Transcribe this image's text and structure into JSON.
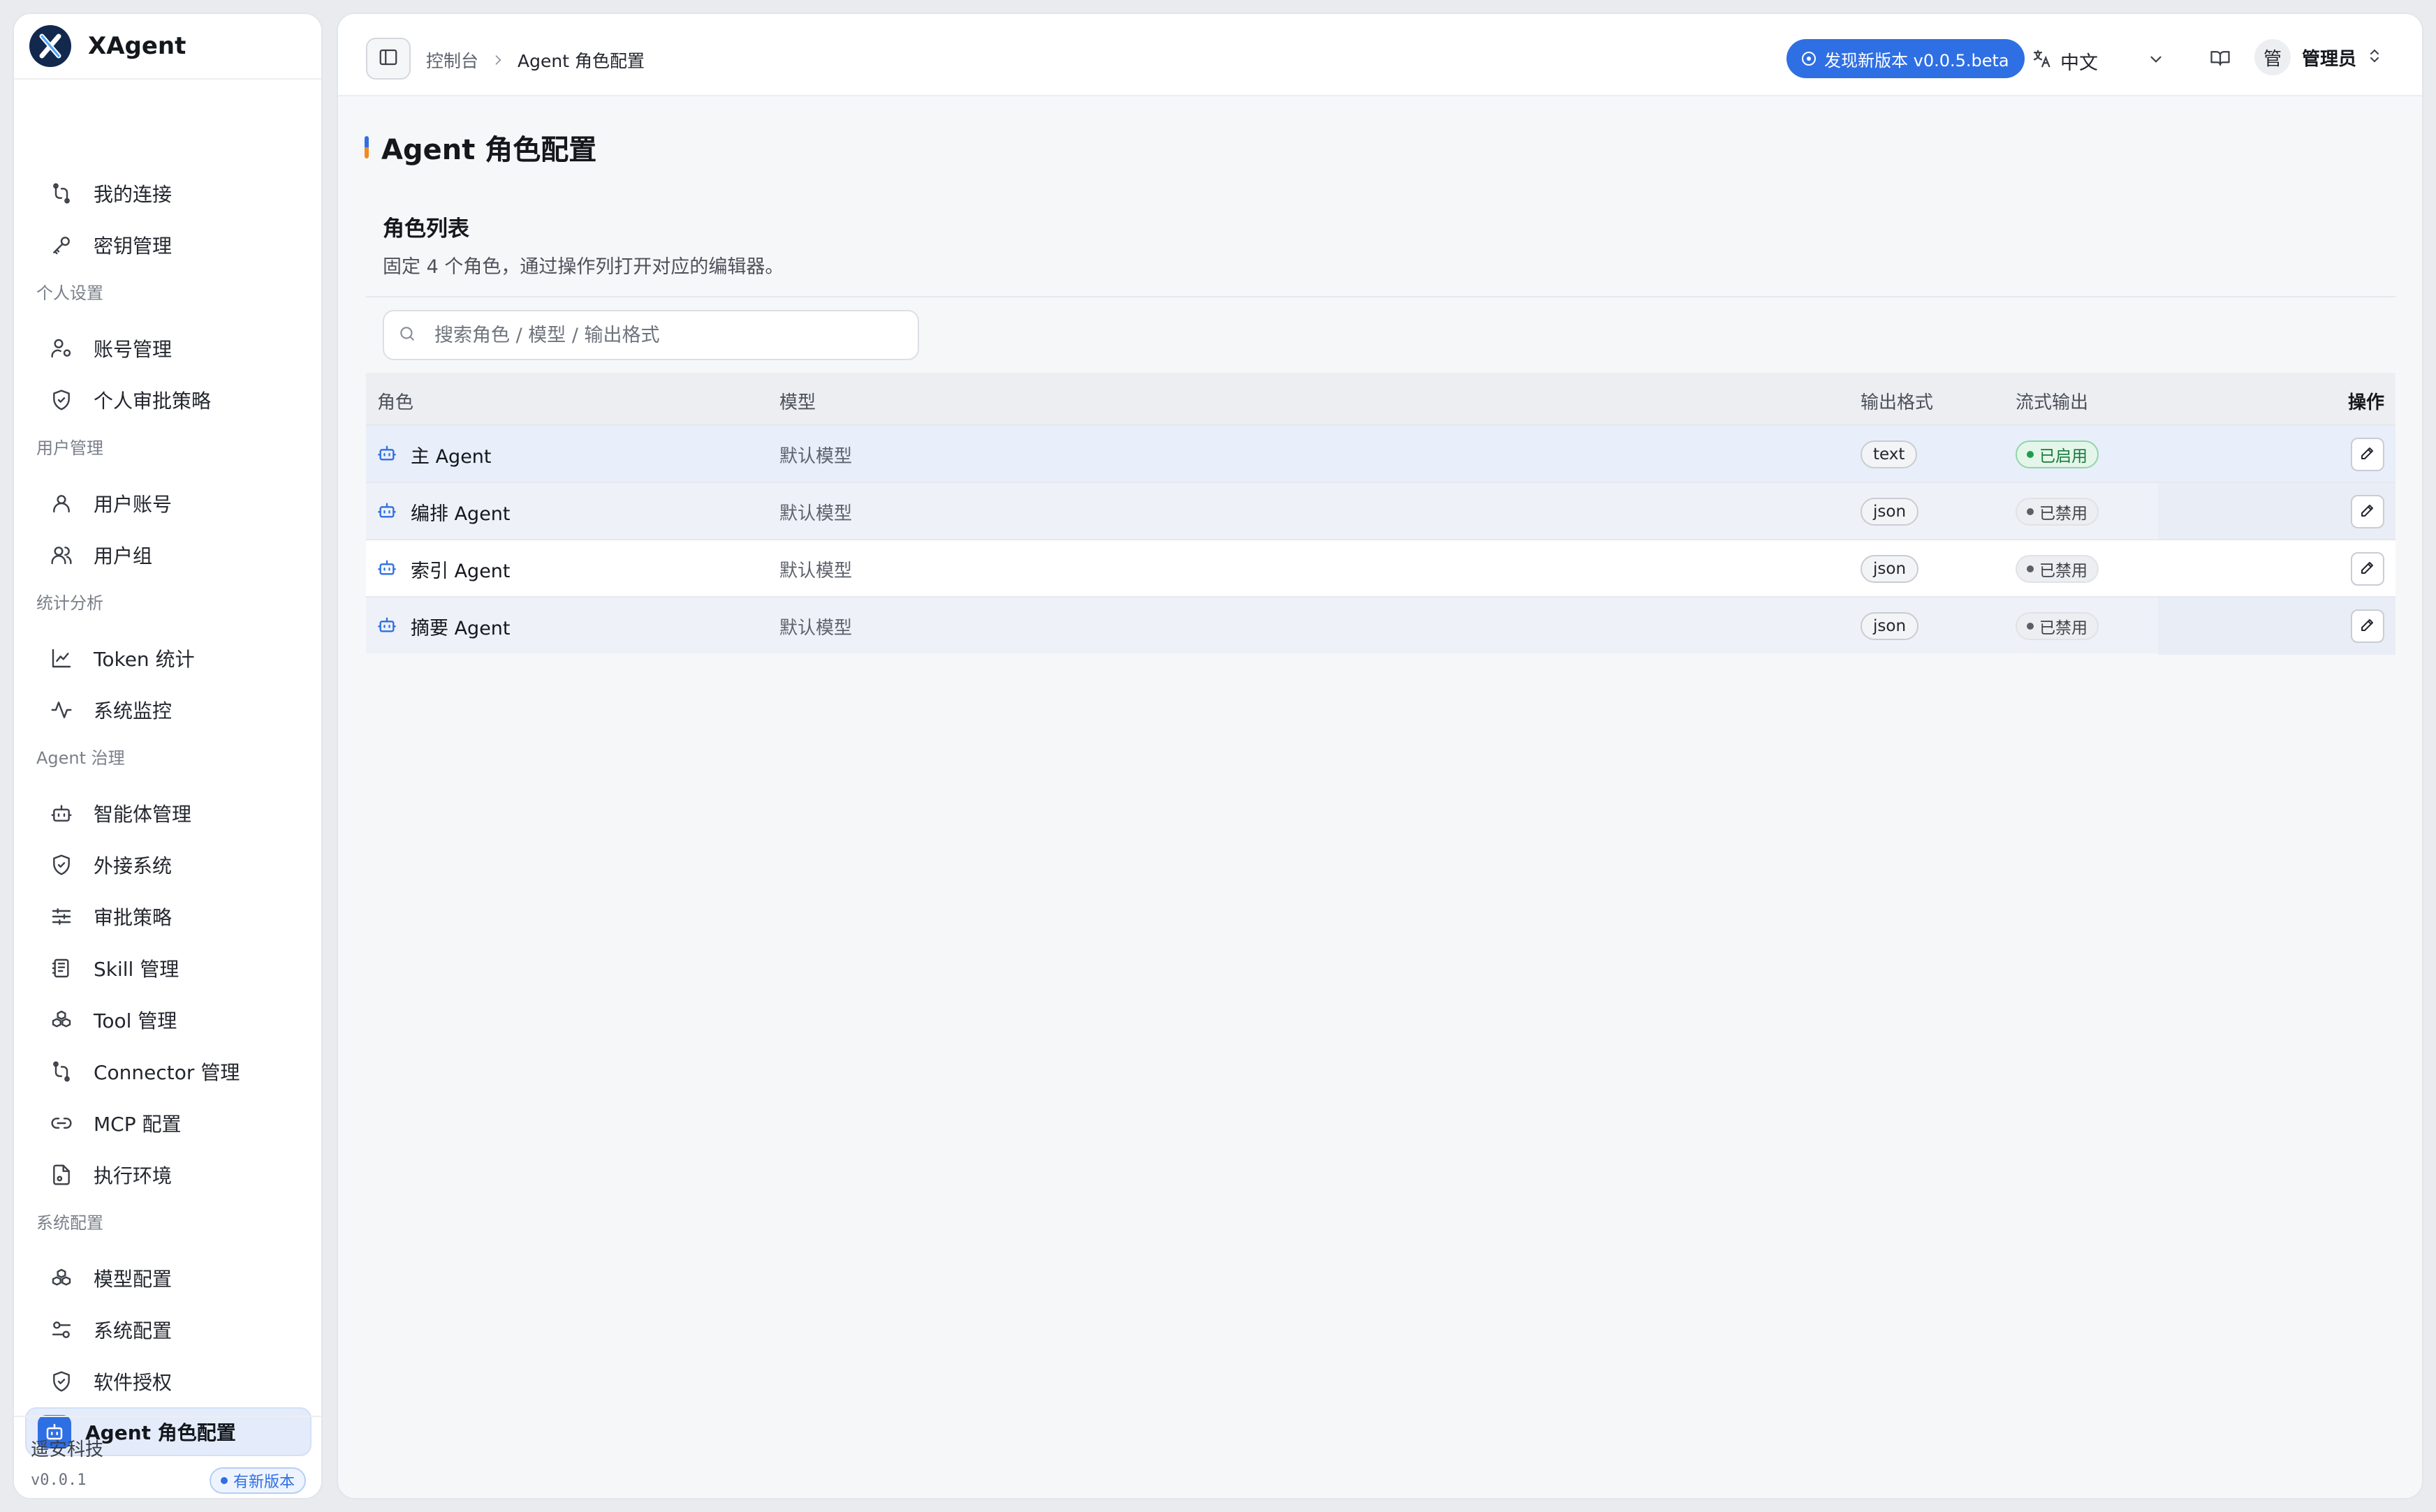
{
  "app": {
    "name": "XAgent"
  },
  "sidebar": {
    "groups": [
      {
        "label": "",
        "items": [
          {
            "label": "我的连接",
            "icon": "connection-icon"
          },
          {
            "label": "密钥管理",
            "icon": "key-icon"
          }
        ]
      },
      {
        "label": "个人设置",
        "items": [
          {
            "label": "账号管理",
            "icon": "user-cog-icon"
          },
          {
            "label": "个人审批策略",
            "icon": "shield-check-icon"
          }
        ]
      },
      {
        "label": "用户管理",
        "items": [
          {
            "label": "用户账号",
            "icon": "user-icon"
          },
          {
            "label": "用户组",
            "icon": "users-icon"
          }
        ]
      },
      {
        "label": "统计分析",
        "items": [
          {
            "label": "Token 统计",
            "icon": "line-chart-icon"
          },
          {
            "label": "系统监控",
            "icon": "activity-icon"
          }
        ]
      },
      {
        "label": "Agent 治理",
        "items": [
          {
            "label": "智能体管理",
            "icon": "bot-icon"
          },
          {
            "label": "外接系统",
            "icon": "shield-icon"
          },
          {
            "label": "审批策略",
            "icon": "sliders-icon"
          },
          {
            "label": "Skill 管理",
            "icon": "notebook-icon"
          },
          {
            "label": "Tool 管理",
            "icon": "boxes-icon"
          },
          {
            "label": "Connector 管理",
            "icon": "connection-icon"
          },
          {
            "label": "MCP 配置",
            "icon": "link-icon"
          },
          {
            "label": "执行环境",
            "icon": "file-code-icon"
          }
        ]
      },
      {
        "label": "系统配置",
        "items": [
          {
            "label": "模型配置",
            "icon": "boxes-icon"
          },
          {
            "label": "系统配置",
            "icon": "settings-icon"
          },
          {
            "label": "软件授权",
            "icon": "shield-check-icon"
          },
          {
            "label": "Agent 角色配置",
            "icon": "bot-icon",
            "active": true
          }
        ]
      }
    ],
    "footer": {
      "company": "遥安科技",
      "version": "v0.0.1",
      "update_badge": "有新版本"
    }
  },
  "topbar": {
    "breadcrumb": {
      "root": "控制台",
      "current": "Agent 角色配置"
    },
    "new_version": "发现新版本 v0.0.5.beta",
    "language": "中文",
    "user": {
      "avatar": "管",
      "name": "管理员"
    }
  },
  "page": {
    "title": "Agent 角色配置",
    "section_title": "角色列表",
    "section_desc": "固定 4 个角色，通过操作列打开对应的编辑器。",
    "search_placeholder": "搜索角色 / 模型 / 输出格式"
  },
  "table": {
    "columns": {
      "role": "角色",
      "model": "模型",
      "format": "输出格式",
      "stream": "流式输出",
      "actions": "操作"
    },
    "rows": [
      {
        "role": "主 Agent",
        "model": "默认模型",
        "format": "text",
        "stream": "已启用",
        "stream_on": true
      },
      {
        "role": "编排 Agent",
        "model": "默认模型",
        "format": "json",
        "stream": "已禁用",
        "stream_on": false
      },
      {
        "role": "索引 Agent",
        "model": "默认模型",
        "format": "json",
        "stream": "已禁用",
        "stream_on": false
      },
      {
        "role": "摘要 Agent",
        "model": "默认模型",
        "format": "json",
        "stream": "已禁用",
        "stream_on": false
      }
    ]
  },
  "colors": {
    "accent": "#2f6fe4",
    "enabled_green": "#1f9d4d",
    "title_mark_orange": "#f08a24"
  }
}
